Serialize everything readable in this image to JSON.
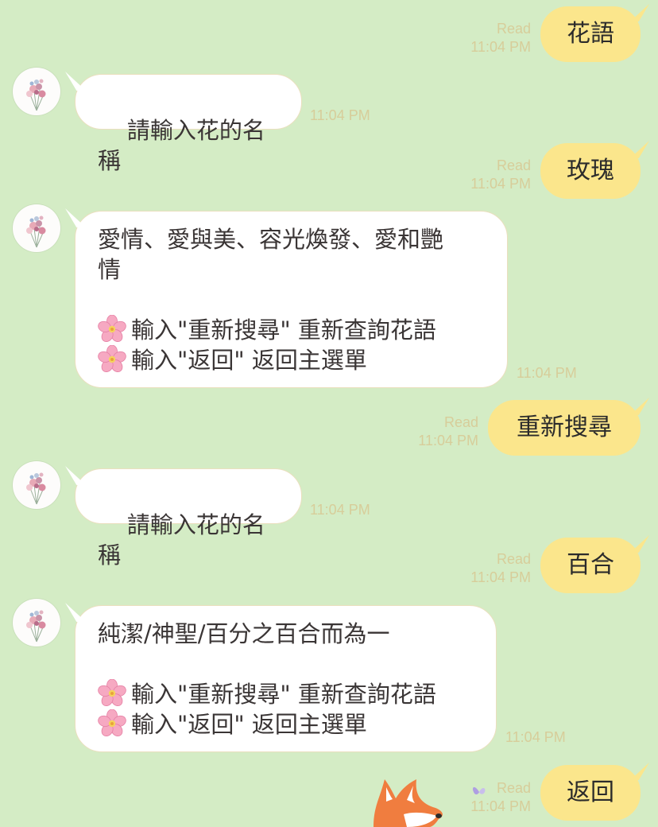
{
  "app": "LINE chat",
  "colors": {
    "background": "#d4ecc5",
    "outgoing_bubble": "#fbe68c",
    "incoming_bubble": "#ffffff",
    "meta_text": "#d7cd9a"
  },
  "avatar_icon": "flower-bouquet",
  "messages": [
    {
      "side": "out",
      "text": "花語",
      "read": "Read",
      "time": "11:04 PM"
    },
    {
      "side": "in",
      "text": "請輸入花的名稱",
      "time": "11:04 PM"
    },
    {
      "side": "out",
      "text": "玫瑰",
      "read": "Read",
      "time": "11:04 PM"
    },
    {
      "side": "in",
      "text_line1": "愛情、愛與美、容光煥發、愛和艷",
      "text_line2": "情",
      "hint1": "輸入\"重新搜尋\" 重新查詢花語",
      "hint2": "輸入\"返回\" 返回主選單",
      "hint_icon": "cherry-blossom",
      "time": "11:04 PM"
    },
    {
      "side": "out",
      "text": "重新搜尋",
      "read": "Read",
      "time": "11:04 PM"
    },
    {
      "side": "in",
      "text": "請輸入花的名稱",
      "time": "11:04 PM"
    },
    {
      "side": "out",
      "text": "百合",
      "read": "Read",
      "time": "11:04 PM"
    },
    {
      "side": "in",
      "text_line1": "純潔/神聖/百分之百合而為一",
      "hint1": "輸入\"重新搜尋\" 重新查詢花語",
      "hint2": "輸入\"返回\" 返回主選單",
      "hint_icon": "cherry-blossom",
      "time": "11:04 PM"
    },
    {
      "side": "out",
      "text": "返回",
      "read": "Read",
      "time": "11:04 PM"
    }
  ],
  "sticker": "fox-sticker"
}
